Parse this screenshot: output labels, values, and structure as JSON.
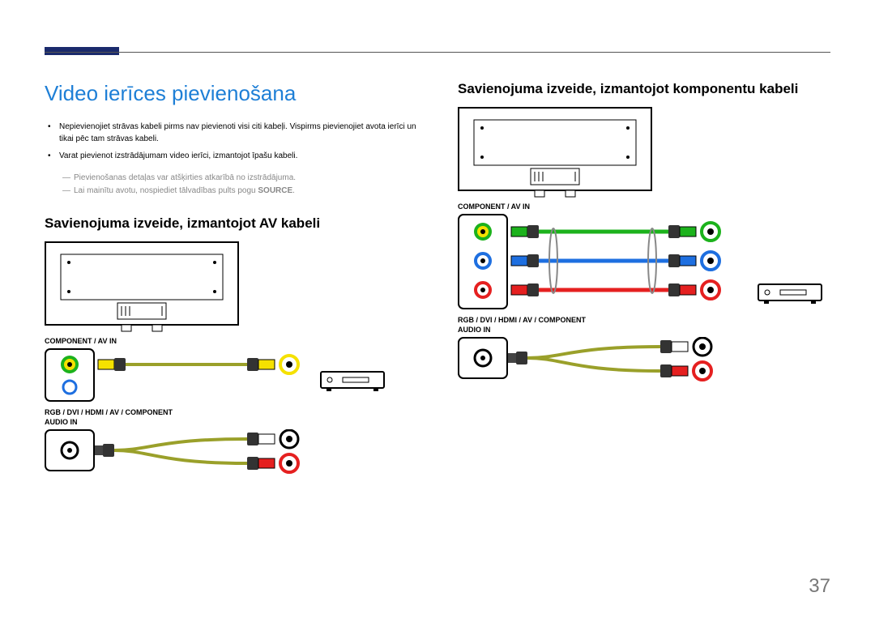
{
  "page_number": "37",
  "main_title": "Video ierīces pievienošana",
  "bullets": [
    "Nepievienojiet strāvas kabeli pirms nav pievienoti visi citi kabeļi.\nVispirms pievienojiet avota ierīci un tikai pēc tam strāvas kabeli.",
    "Varat pievienot izstrādājumam video ierīci, izmantojot īpašu kabeli."
  ],
  "notes": [
    "Pievienošanas detaļas var atšķirties atkarībā no izstrādājuma.",
    "Lai mainītu avotu, nospiediet tālvadības pults pogu "
  ],
  "note_bold_suffix": "SOURCE",
  "note_period": ".",
  "left_subtitle": "Savienojuma izveide, izmantojot AV kabeli",
  "right_subtitle": "Savienojuma izveide, izmantojot komponentu kabeli",
  "port_label_1": "COMPONENT / AV IN",
  "port_label_2": "RGB / DVI / HDMI / AV / COMPONENT",
  "port_label_3": "AUDIO IN",
  "colors": {
    "yellow": "#f5e100",
    "green": "#1cb21c",
    "blue": "#1e6fe0",
    "red": "#e52020",
    "white": "#ffffff",
    "olive": "#9aa02a"
  }
}
